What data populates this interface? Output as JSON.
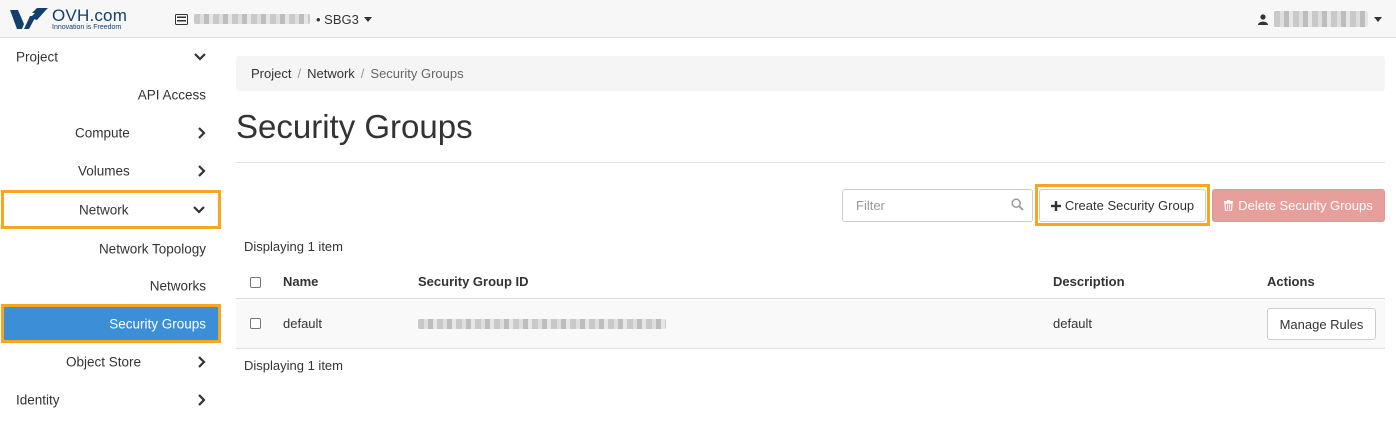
{
  "header": {
    "brand_name": "OVH.com",
    "brand_tagline": "Innovation is Freedom",
    "project_icon": "server-icon",
    "region": "SBG3",
    "user_icon": "user-icon"
  },
  "sidebar": {
    "project_label": "Project",
    "api_access": "API Access",
    "compute": "Compute",
    "volumes": "Volumes",
    "network": "Network",
    "network_topology": "Network Topology",
    "networks": "Networks",
    "security_groups": "Security Groups",
    "object_store": "Object Store",
    "identity": "Identity"
  },
  "breadcrumb": [
    "Project",
    "Network",
    "Security Groups"
  ],
  "page": {
    "title": "Security Groups"
  },
  "toolbar": {
    "filter_placeholder": "Filter",
    "create_label": "Create Security Group",
    "delete_label": "Delete Security Groups"
  },
  "table": {
    "count_top": "Displaying 1 item",
    "count_bottom": "Displaying 1 item",
    "columns": [
      "Name",
      "Security Group ID",
      "Description",
      "Actions"
    ],
    "rows": [
      {
        "name": "default",
        "description": "default",
        "action": "Manage Rules"
      }
    ]
  },
  "colors": {
    "accent": "#3c8fd6",
    "highlight": "#f5a623",
    "danger": "#e79f9c"
  }
}
